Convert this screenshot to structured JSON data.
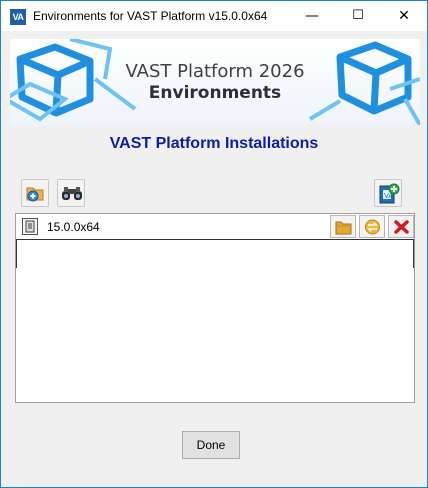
{
  "window": {
    "title": "Environments for VAST Platform v15.0.0x64",
    "app_icon_text": "VA",
    "controls": {
      "minimize": "—",
      "maximize": "☐",
      "close": "✕"
    }
  },
  "banner": {
    "line1": "VAST Platform 2026",
    "line2": "Environments"
  },
  "heading": "VAST Platform Installations",
  "toolbar": {
    "add_icon": "add-folder-icon",
    "find_icon": "binoculars-icon",
    "new_environment_icon": "new-environment-icon"
  },
  "installations": [
    {
      "name": "15.0.0x64",
      "actions": [
        "open-folder-icon",
        "switch-icon",
        "delete-icon"
      ]
    }
  ],
  "buttons": {
    "done": "Done"
  },
  "colors": {
    "heading": "#0b1fa6",
    "window_border": "#1883d7",
    "banner_blue": "#1f8fe0"
  }
}
